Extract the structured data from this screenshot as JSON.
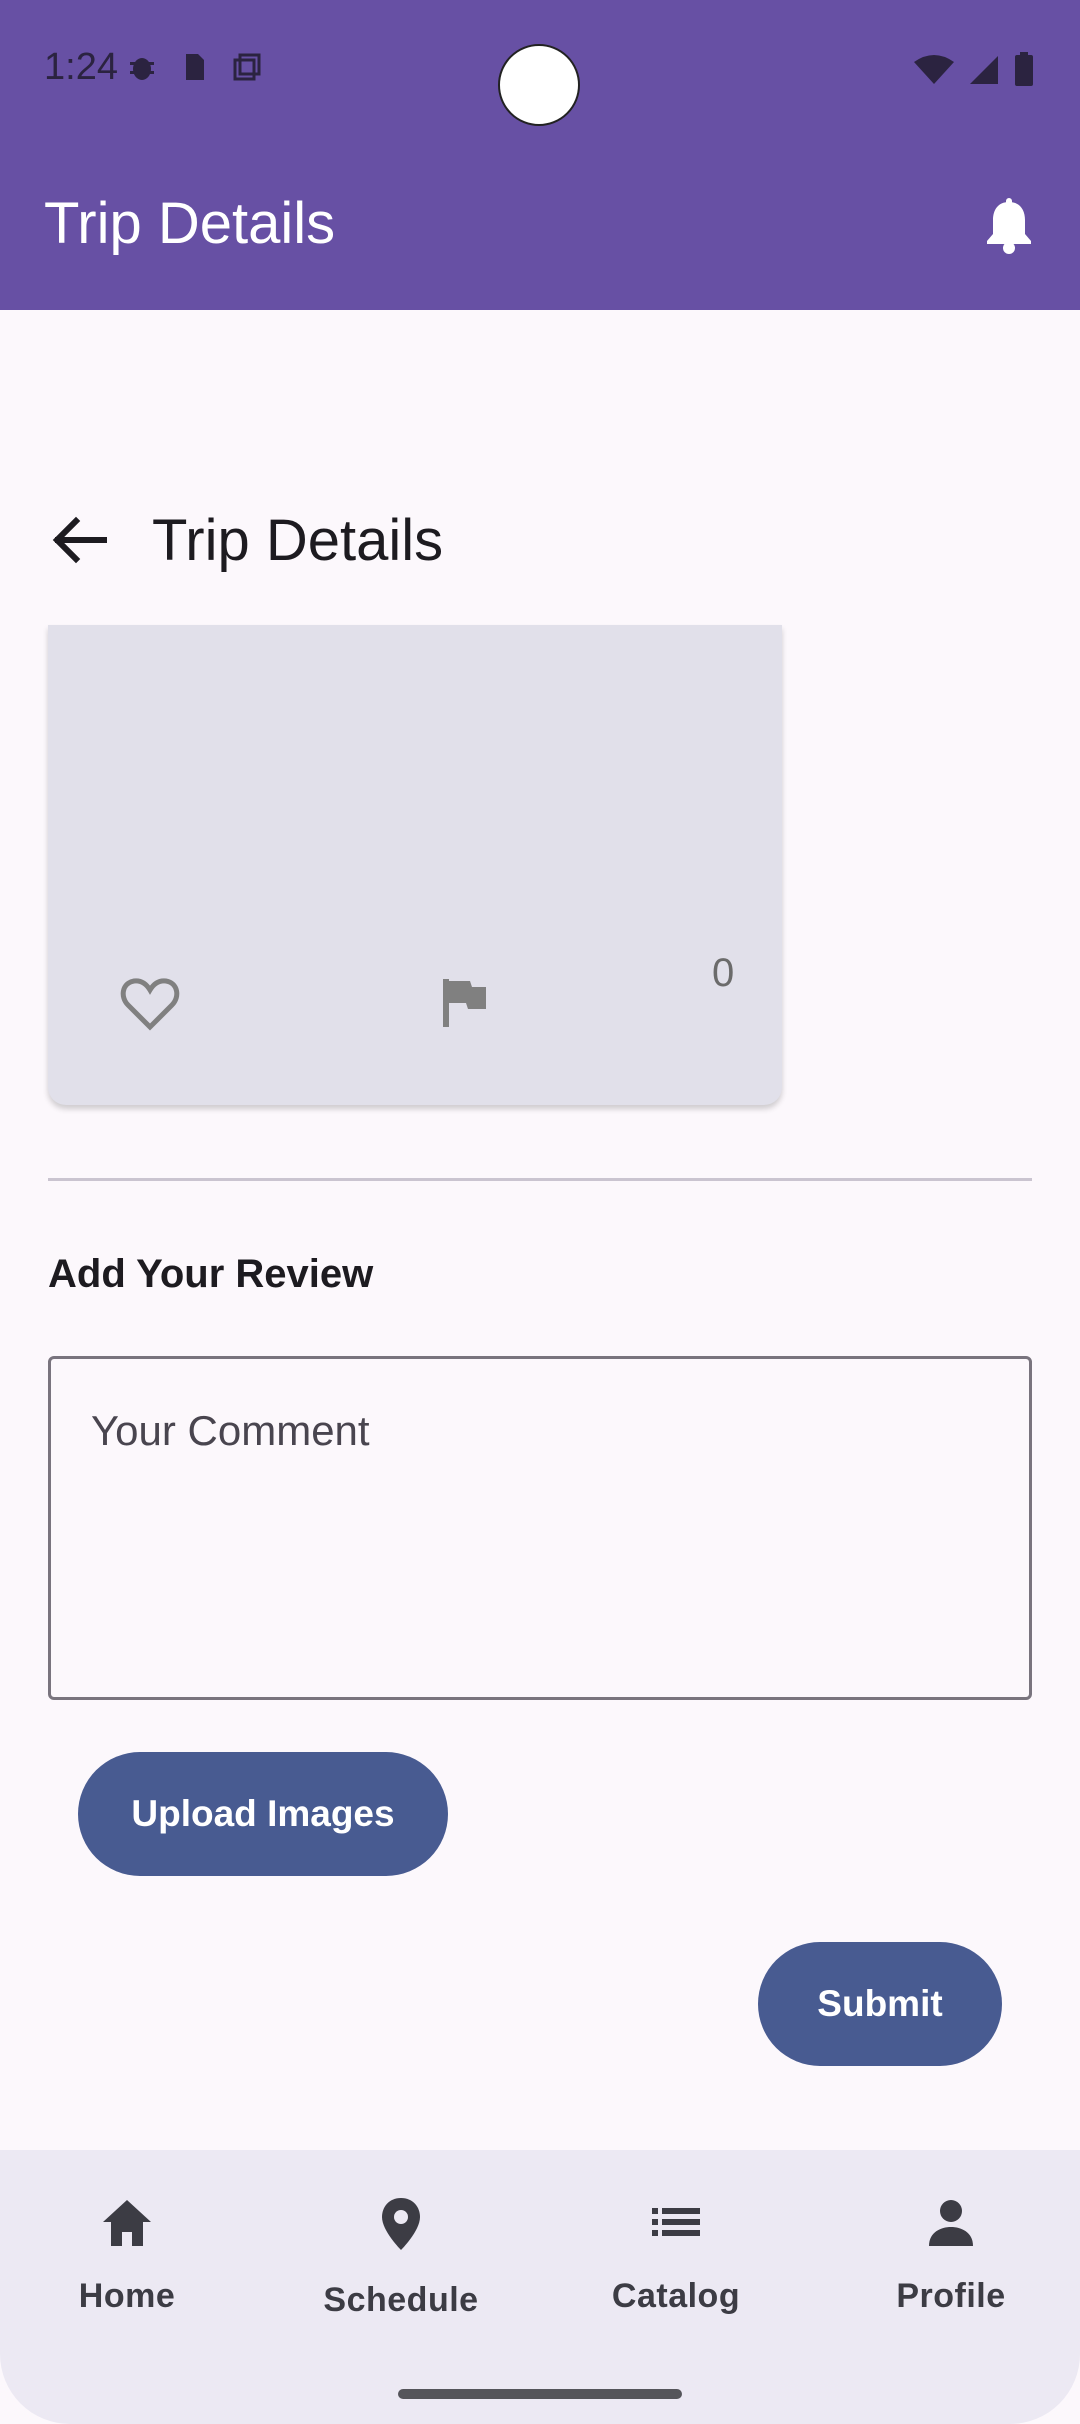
{
  "status_bar": {
    "time": "1:24"
  },
  "app_bar": {
    "title": "Trip Details"
  },
  "subheader": {
    "title": "Trip Details"
  },
  "card": {
    "count": "0"
  },
  "review": {
    "label": "Add Your Review",
    "comment_placeholder": "Your Comment",
    "upload_label": "Upload Images",
    "submit_label": "Submit"
  },
  "nav": {
    "items": [
      {
        "label": "Home",
        "icon": "home-icon"
      },
      {
        "label": "Schedule",
        "icon": "location-pin-icon"
      },
      {
        "label": "Catalog",
        "icon": "list-icon"
      },
      {
        "label": "Profile",
        "icon": "person-icon"
      }
    ]
  },
  "colors": {
    "app_bar": "#6750a4",
    "button": "#485b91",
    "background": "#fcf8fc",
    "card": "#e1e0ea",
    "nav_background": "#ece9f3"
  }
}
